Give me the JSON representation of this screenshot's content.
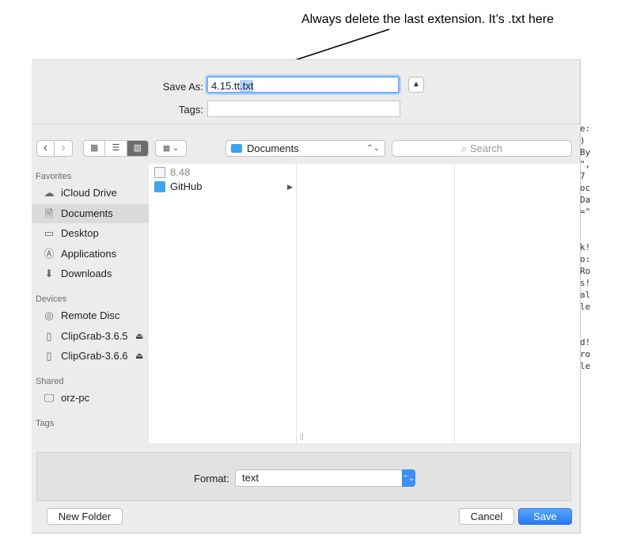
{
  "annotation": {
    "text": "Always delete the last extension. It’s .txt here"
  },
  "save_as": {
    "label": "Save As:",
    "value_prefix": "4.15.tt",
    "value_selected": ".txt",
    "expand_icon": "chevron-up-icon"
  },
  "tags": {
    "label": "Tags:",
    "value": ""
  },
  "toolbar": {
    "back_icon": "chevron-left-icon",
    "forward_icon": "chevron-right-icon",
    "view_modes": [
      "icon-view-icon",
      "list-view-icon",
      "column-view-icon"
    ],
    "arrange_icon": "arrange-grid-icon",
    "location": "Documents",
    "search_placeholder": "Search",
    "search_icon": "magnifier-icon"
  },
  "sidebar": {
    "favorites_header": "Favorites",
    "favorites": [
      {
        "label": "iCloud Drive",
        "icon": "cloud-icon"
      },
      {
        "label": "Documents",
        "icon": "documents-icon",
        "selected": true
      },
      {
        "label": "Desktop",
        "icon": "desktop-icon"
      },
      {
        "label": "Applications",
        "icon": "applications-icon"
      },
      {
        "label": "Downloads",
        "icon": "downloads-icon"
      }
    ],
    "devices_header": "Devices",
    "devices": [
      {
        "label": "Remote Disc",
        "icon": "disc-icon"
      },
      {
        "label": "ClipGrab-3.6.5",
        "icon": "drive-icon",
        "eject": true
      },
      {
        "label": "ClipGrab-3.6.6",
        "icon": "drive-icon",
        "eject": true
      }
    ],
    "shared_header": "Shared",
    "shared": [
      {
        "label": "orz-pc",
        "icon": "computer-icon"
      }
    ],
    "tags_header": "Tags"
  },
  "browser": {
    "items": [
      {
        "label": "8.48",
        "type": "document",
        "dimmed": true
      },
      {
        "label": "GitHub",
        "type": "folder"
      }
    ]
  },
  "format": {
    "label": "Format:",
    "value": "text"
  },
  "buttons": {
    "new_folder": "New Folder",
    "cancel": "Cancel",
    "save": "Save"
  }
}
